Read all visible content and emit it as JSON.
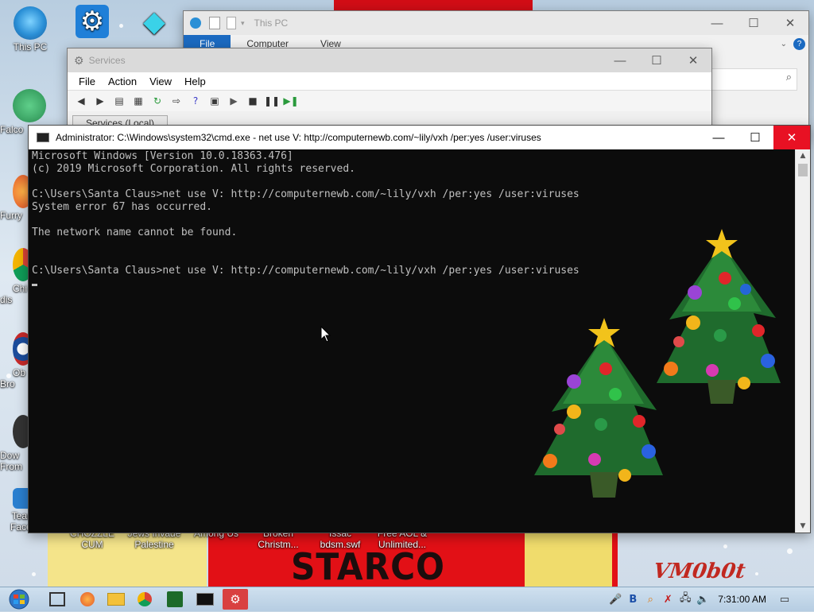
{
  "desktop": {
    "icons": [
      {
        "label": "This PC"
      },
      {
        "label": ""
      },
      {
        "label": ""
      },
      {
        "label": "Falco"
      },
      {
        "label": "Furry"
      },
      {
        "label": "Chi dis"
      },
      {
        "label": "Ob Bro"
      },
      {
        "label": "Dow From"
      },
      {
        "label": "TeamOS Facebo..."
      },
      {
        "label": "CHOZZLE CUM"
      },
      {
        "label": "Jews Invade Palestine"
      },
      {
        "label": "Among Us"
      },
      {
        "label": "Broken Christm..."
      },
      {
        "label": "Issac bdsm.swf"
      },
      {
        "label": "Free AOL & Unlimited..."
      }
    ],
    "wallpaper_text": "STARCO",
    "watermark": "VM0b0t"
  },
  "explorer": {
    "title": "This PC",
    "tabs": [
      "File",
      "Computer",
      "View"
    ]
  },
  "services": {
    "title": "Services",
    "menu": [
      "File",
      "Action",
      "View",
      "Help"
    ],
    "tree_tab": "Services (Local)"
  },
  "cmd": {
    "title": "Administrator: C:\\Windows\\system32\\cmd.exe - net  use V: http://computernewb.com/~lily/vxh /per:yes /user:viruses",
    "lines": [
      "Microsoft Windows [Version 10.0.18363.476]",
      "(c) 2019 Microsoft Corporation. All rights reserved.",
      "",
      "C:\\Users\\Santa Claus>net use V: http://computernewb.com/~lily/vxh /per:yes /user:viruses",
      "System error 67 has occurred.",
      "",
      "The network name cannot be found.",
      "",
      "",
      "C:\\Users\\Santa Claus>net use V: http://computernewb.com/~lily/vxh /per:yes /user:viruses"
    ]
  },
  "taskbar": {
    "clock": "7:31:00 AM",
    "tray_icons": [
      "microphone-icon",
      "bluetooth-icon",
      "search-icon",
      "firewall-icon",
      "network-icon",
      "volume-icon"
    ]
  },
  "colors": {
    "accent_blue": "#1b6ac1",
    "close_red": "#e81123",
    "console_bg": "#0c0c0c",
    "console_fg": "#c0c0c0"
  }
}
